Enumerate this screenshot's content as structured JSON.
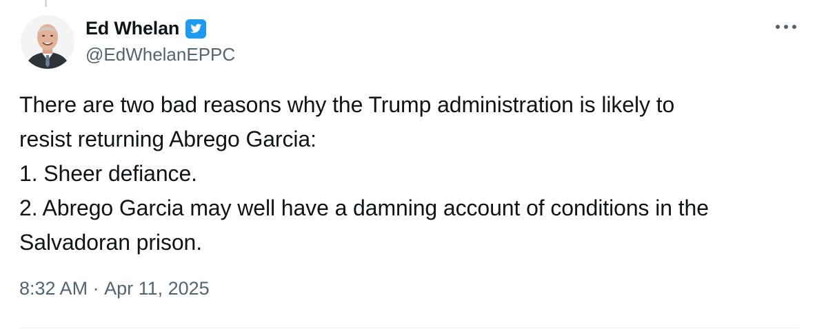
{
  "colors": {
    "text_primary": "#0f1419",
    "text_secondary": "#536471",
    "verified_blue": "#1d9bf0",
    "divider": "#eff3f4"
  },
  "author": {
    "display_name": "Ed Whelan",
    "handle": "@EdWhelanEPPC",
    "verified": true,
    "verified_icon": "twitter-bird-verified-icon"
  },
  "menu": {
    "more_icon": "ellipsis-icon"
  },
  "tweet": {
    "lines": [
      "There are two bad reasons why the Trump administration is likely to",
      "resist returning Abrego Garcia:",
      "1. Sheer defiance.",
      "2. Abrego Garcia may well have a damning account of conditions in the",
      "Salvadoran prison."
    ],
    "time": "8:32 AM",
    "separator": " · ",
    "date": "Apr 11, 2025"
  }
}
